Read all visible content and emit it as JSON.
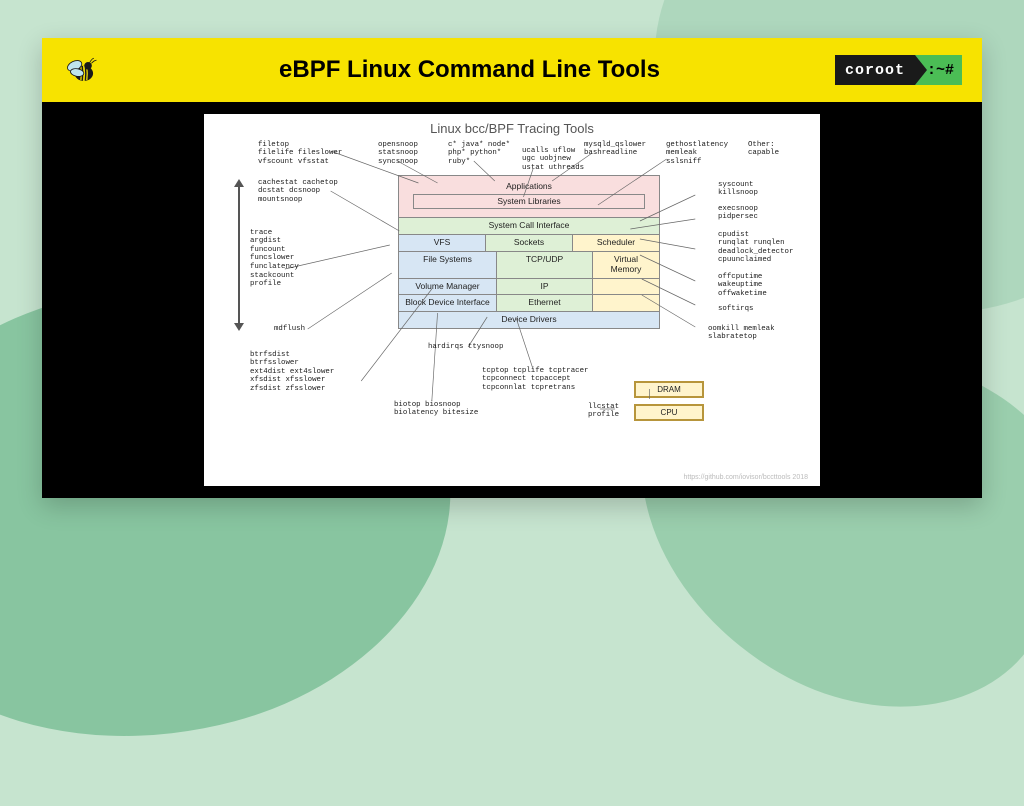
{
  "header": {
    "title": "eBPF Linux Command Line Tools",
    "logo_name": "coroot",
    "logo_prompt": ":~#"
  },
  "slide": {
    "title": "Linux bcc/BPF Tracing Tools",
    "credit": "https://github.com/iovisor/bccttools 2018"
  },
  "layers": {
    "applications": "Applications",
    "syslib": "System Libraries",
    "sci": "System Call Interface",
    "vfs": "VFS",
    "sockets": "Sockets",
    "scheduler": "Scheduler",
    "filesystems": "File Systems",
    "tcpudp": "TCP/UDP",
    "volmgr": "Volume Manager",
    "ip": "IP",
    "virtmem": "Virtual\nMemory",
    "bdi": "Block Device Interface",
    "ethernet": "Ethernet",
    "devdrv": "Device Drivers",
    "dram": "DRAM",
    "cpu": "CPU"
  },
  "labels": {
    "filetop": "filetop\nfilelife fileslower\nvfscount vfsstat",
    "opensnoop": "opensnoop\nstatsnoop\nsyncsnoop",
    "langs": "c* java* node*\nphp* python*\nruby*",
    "ucalls": "ucalls uflow\nugc uobjnew\nustat uthreads",
    "mysqld": "mysqld_qslower\nbashreadline",
    "gethost": "gethostlatency\nmemleak\nsslsniff",
    "other": "Other:\ncapable",
    "cachestat": "cachestat cachetop\ndcstat dcsnoop\nmountsnoop",
    "trace": "trace\nargdist\nfuncount\nfuncslower\nfunclatency\nstackcount\nprofile",
    "mdflush": "mdflush",
    "btrfs": "btrfsdist\nbtrfsslower\next4dist ext4slower\nxfsdist xfsslower\nzfsdist zfsslower",
    "biotop": "biotop biosnoop\nbiolatency bitesize",
    "hardirqs": "hardirqs ttysnoop",
    "tcptop": "tcptop tcplife tcptracer\ntcpconnect tcpaccept\ntcpconnlat tcpretrans",
    "llcstat": "llcstat\nprofile",
    "syscount": "syscount\nkillsnoop",
    "execsnoop": "execsnoop\npidpersec",
    "cpudist": "cpudist\nrunqlat runqlen\ndeadlock_detector\ncpuunclaimed",
    "offcpu": "offcputime\nwakeuptime\noffwaketime",
    "softirqs": "softirqs",
    "oomkill": "oomkill memleak\nslabratetop"
  }
}
